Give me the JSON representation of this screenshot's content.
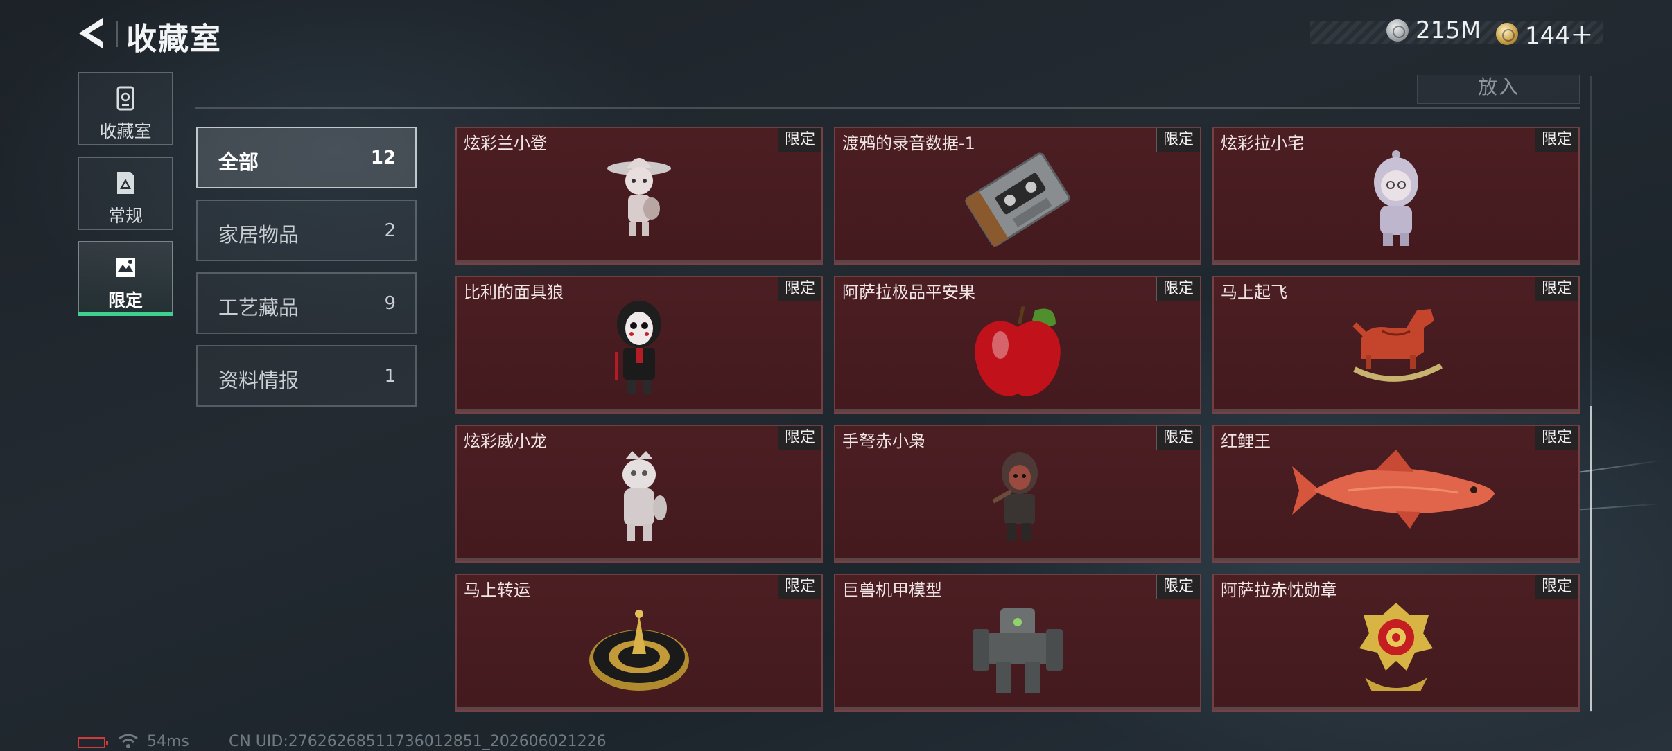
{
  "header": {
    "title": "收藏室",
    "currency": [
      {
        "icon": "silver-coin-icon",
        "value": "215M"
      },
      {
        "icon": "gold-coin-icon",
        "value": "144＋"
      }
    ]
  },
  "nav": [
    {
      "label": "收藏室",
      "icon": "collection-room-icon",
      "active": false
    },
    {
      "label": "常规",
      "icon": "regular-icon",
      "active": false
    },
    {
      "label": "限定",
      "icon": "limited-icon",
      "active": true
    }
  ],
  "toolbar": {
    "put_label": "放入"
  },
  "categories": [
    {
      "label": "全部",
      "count": "12",
      "active": true
    },
    {
      "label": "家居物品",
      "count": "2",
      "active": false
    },
    {
      "label": "工艺藏品",
      "count": "9",
      "active": false
    },
    {
      "label": "资料情报",
      "count": "1",
      "active": false
    }
  ],
  "items": [
    {
      "name": "炫彩兰小登",
      "tag": "限定",
      "icon": "sombrero-figurine-icon"
    },
    {
      "name": "渡鸦的录音数据-1",
      "tag": "限定",
      "icon": "cassette-tape-icon"
    },
    {
      "name": "炫彩拉小宅",
      "tag": "限定",
      "icon": "hooded-figurine-icon"
    },
    {
      "name": "比利的面具狼",
      "tag": "限定",
      "icon": "puppet-mask-figurine-icon"
    },
    {
      "name": "阿萨拉极品平安果",
      "tag": "限定",
      "icon": "red-apple-icon"
    },
    {
      "name": "马上起飞",
      "tag": "限定",
      "icon": "rocking-horse-icon"
    },
    {
      "name": "炫彩威小龙",
      "tag": "限定",
      "icon": "dragon-figurine-icon"
    },
    {
      "name": "手弩赤小枭",
      "tag": "限定",
      "icon": "crossbow-figurine-icon"
    },
    {
      "name": "红鲤王",
      "tag": "限定",
      "icon": "red-carp-icon"
    },
    {
      "name": "马上转运",
      "tag": "限定",
      "icon": "fortune-wheel-icon"
    },
    {
      "name": "巨兽机甲模型",
      "tag": "限定",
      "icon": "mech-model-icon"
    },
    {
      "name": "阿萨拉赤忱勋章",
      "tag": "限定",
      "icon": "medal-icon"
    }
  ],
  "status": {
    "ping": "54ms",
    "uid": "CN UID:27626268511736012851_202606021226"
  }
}
